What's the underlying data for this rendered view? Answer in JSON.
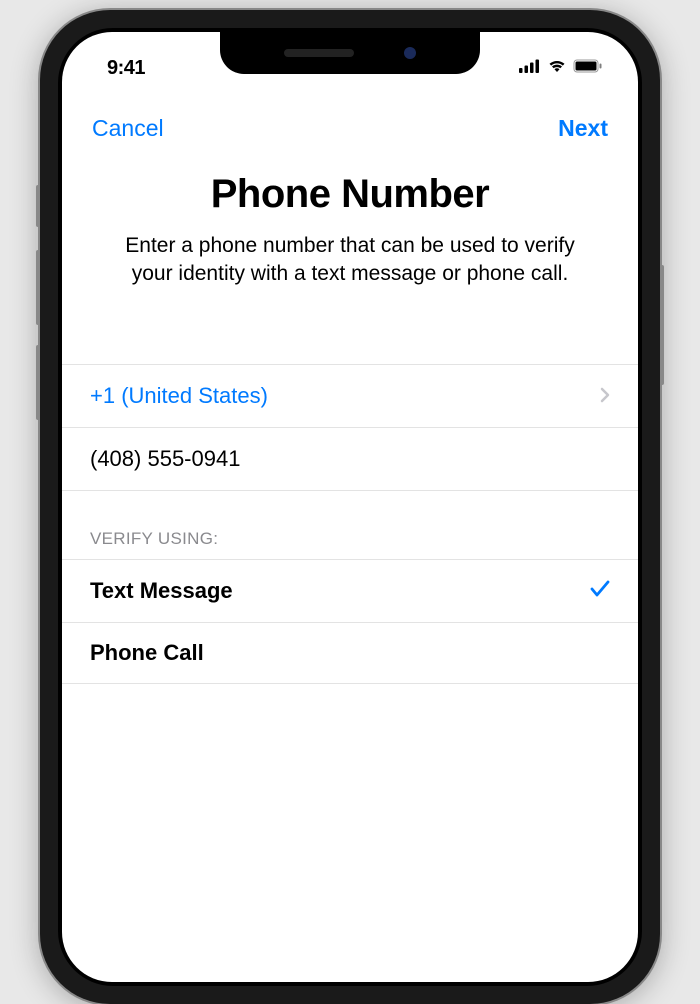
{
  "statusBar": {
    "time": "9:41"
  },
  "nav": {
    "cancel": "Cancel",
    "next": "Next"
  },
  "header": {
    "title": "Phone Number",
    "subtitle": "Enter a phone number that can be used to verify your identity with a text message or phone call."
  },
  "form": {
    "countryCode": "+1 (United States)",
    "phoneNumber": "(408) 555-0941"
  },
  "verify": {
    "sectionLabel": "VERIFY USING:",
    "options": [
      {
        "label": "Text Message",
        "selected": true
      },
      {
        "label": "Phone Call",
        "selected": false
      }
    ]
  }
}
